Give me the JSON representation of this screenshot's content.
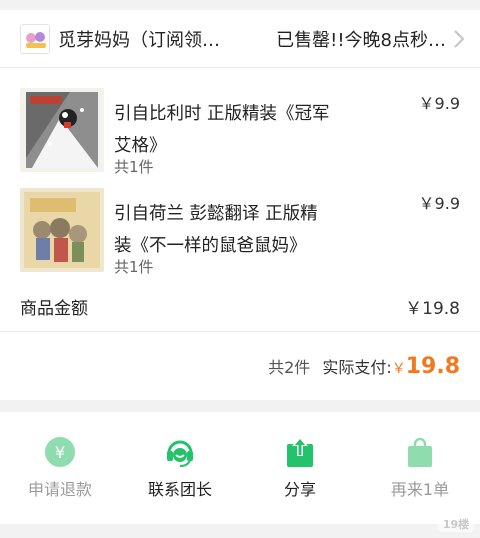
{
  "shop": {
    "name": "觅芽妈妈（订阅领…",
    "status": "已售罄!!今晚8点秒…"
  },
  "products": [
    {
      "title": "引自比利时 正版精装《冠军艾格》",
      "quantity": "共1件",
      "price": "￥9.9"
    },
    {
      "title": "引自荷兰 彭懿翻译 正版精装《不一样的鼠爸鼠妈》",
      "quantity": "共1件",
      "price": "￥9.9"
    }
  ],
  "summary": {
    "label": "商品金额",
    "value": "￥19.8"
  },
  "total": {
    "count": "共2件",
    "label": "实际支付:",
    "currency": "￥",
    "value": "19.8"
  },
  "actions": [
    {
      "label": "申请退款",
      "icon": "refund-icon"
    },
    {
      "label": "联系团长",
      "icon": "headset-icon"
    },
    {
      "label": "分享",
      "icon": "share-icon"
    },
    {
      "label": "再来1单",
      "icon": "shopping-bag-icon"
    }
  ],
  "colors": {
    "accent_green": "#22c36a",
    "light_green": "#8fdcae",
    "price_orange": "#f07a22"
  }
}
